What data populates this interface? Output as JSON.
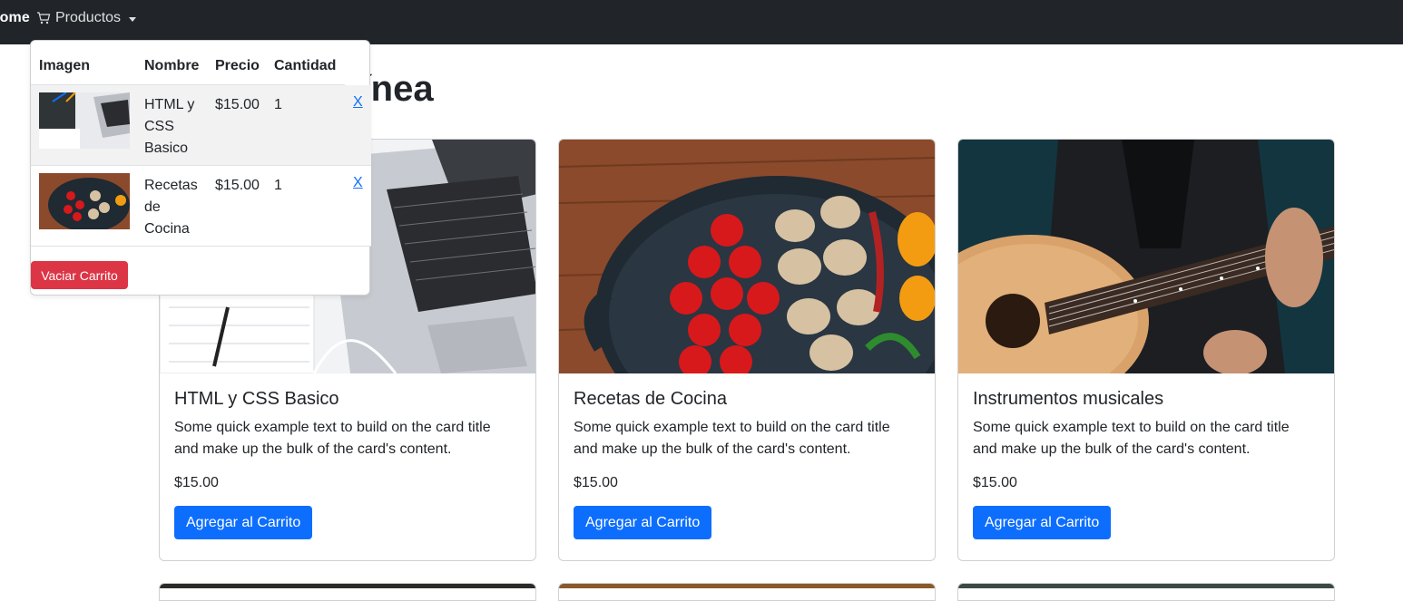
{
  "navbar": {
    "home_label": "Home",
    "products_label": "Productos"
  },
  "page": {
    "heading": "Tienda en Línea"
  },
  "cart": {
    "headers": [
      "Imagen",
      "Nombre",
      "Precio",
      "Cantidad"
    ],
    "items": [
      {
        "name": "HTML y CSS Basico",
        "price": "$15.00",
        "qty": "1",
        "remove": "X"
      },
      {
        "name": "Recetas de Cocina",
        "price": "$15.00",
        "qty": "1",
        "remove": "X"
      }
    ],
    "empty_button": "Vaciar Carrito"
  },
  "courses": [
    {
      "title": "HTML y CSS Basico",
      "text": "Some quick example text to build on the card title and make up the bulk of the card's content.",
      "price": "$15.00",
      "button": "Agregar al Carrito"
    },
    {
      "title": "Recetas de Cocina",
      "text": "Some quick example text to build on the card title and make up the bulk of the card's content.",
      "price": "$15.00",
      "button": "Agregar al Carrito"
    },
    {
      "title": "Instrumentos musicales",
      "text": "Some quick example text to build on the card title and make up the bulk of the card's content.",
      "price": "$15.00",
      "button": "Agregar al Carrito"
    }
  ],
  "colors": {
    "navbar": "#212529",
    "primary": "#0d6efd",
    "danger": "#dc3545"
  }
}
